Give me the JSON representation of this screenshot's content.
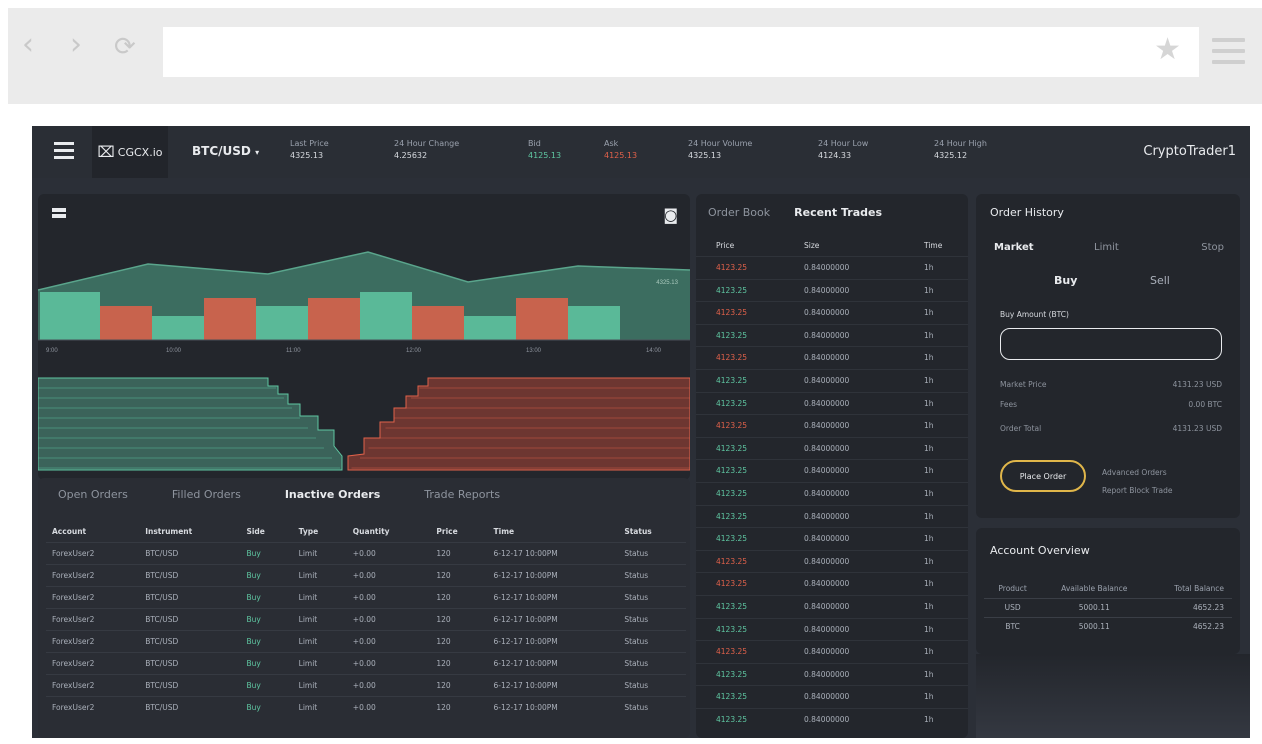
{
  "browser": {
    "back_icon": "chevron-left-icon",
    "forward_icon": "chevron-right-icon",
    "reload_icon": "reload-icon",
    "url_value": "",
    "bookmark_icon": "star-icon",
    "menu_icon": "hamburger-menu-icon"
  },
  "topbar": {
    "logo_text": "CGCX.io",
    "pair": "BTC/USD",
    "pair_caret": "▾",
    "stats": [
      {
        "label": "Last Price",
        "value": "4325.13",
        "color": "neutral"
      },
      {
        "label": "24 Hour Change",
        "value": "4.25632",
        "color": "neutral"
      },
      {
        "label": "Bid",
        "value": "4125.13",
        "color": "green"
      },
      {
        "label": "Ask",
        "value": "4125.13",
        "color": "red"
      },
      {
        "label": "24 Hour Volume",
        "value": "4325.13",
        "color": "neutral"
      },
      {
        "label": "24 Hour Low",
        "value": "4124.33",
        "color": "neutral"
      },
      {
        "label": "24 Hour High",
        "value": "4325.12",
        "color": "neutral"
      }
    ],
    "user": "CryptoTrader1"
  },
  "chart": {
    "last_label": "4325.13",
    "x_ticks": [
      "9:00",
      "10:00",
      "11:00",
      "12:00",
      "13:00",
      "14:00"
    ],
    "colors": {
      "up": "#5fc7a2",
      "down": "#e0614a",
      "area": "#4a8c78"
    }
  },
  "orders": {
    "tabs": [
      "Open Orders",
      "Filled Orders",
      "Inactive Orders",
      "Trade Reports"
    ],
    "active_tab": 2,
    "columns": [
      "Account",
      "Instrument",
      "Side",
      "Type",
      "Quantity",
      "Price",
      "Time",
      "Status"
    ],
    "rows": [
      [
        "ForexUser2",
        "BTC/USD",
        "Buy",
        "Limit",
        "+0.00",
        "120",
        "6-12-17 10:00PM",
        "Status"
      ],
      [
        "ForexUser2",
        "BTC/USD",
        "Buy",
        "Limit",
        "+0.00",
        "120",
        "6-12-17 10:00PM",
        "Status"
      ],
      [
        "ForexUser2",
        "BTC/USD",
        "Buy",
        "Limit",
        "+0.00",
        "120",
        "6-12-17 10:00PM",
        "Status"
      ],
      [
        "ForexUser2",
        "BTC/USD",
        "Buy",
        "Limit",
        "+0.00",
        "120",
        "6-12-17 10:00PM",
        "Status"
      ],
      [
        "ForexUser2",
        "BTC/USD",
        "Buy",
        "Limit",
        "+0.00",
        "120",
        "6-12-17 10:00PM",
        "Status"
      ],
      [
        "ForexUser2",
        "BTC/USD",
        "Buy",
        "Limit",
        "+0.00",
        "120",
        "6-12-17 10:00PM",
        "Status"
      ],
      [
        "ForexUser2",
        "BTC/USD",
        "Buy",
        "Limit",
        "+0.00",
        "120",
        "6-12-17 10:00PM",
        "Status"
      ],
      [
        "ForexUser2",
        "BTC/USD",
        "Buy",
        "Limit",
        "+0.00",
        "120",
        "6-12-17 10:00PM",
        "Status"
      ]
    ]
  },
  "book": {
    "tabs": [
      "Order Book",
      "Recent Trades"
    ],
    "active_tab": 1,
    "columns": [
      "Price",
      "Size",
      "Time"
    ],
    "rows": [
      {
        "price": "4123.25",
        "size": "0.84000000",
        "time": "1h",
        "side": "r"
      },
      {
        "price": "4123.25",
        "size": "0.84000000",
        "time": "1h",
        "side": "g"
      },
      {
        "price": "4123.25",
        "size": "0.84000000",
        "time": "1h",
        "side": "r"
      },
      {
        "price": "4123.25",
        "size": "0.84000000",
        "time": "1h",
        "side": "g"
      },
      {
        "price": "4123.25",
        "size": "0.84000000",
        "time": "1h",
        "side": "r"
      },
      {
        "price": "4123.25",
        "size": "0.84000000",
        "time": "1h",
        "side": "g"
      },
      {
        "price": "4123.25",
        "size": "0.84000000",
        "time": "1h",
        "side": "g"
      },
      {
        "price": "4123.25",
        "size": "0.84000000",
        "time": "1h",
        "side": "r"
      },
      {
        "price": "4123.25",
        "size": "0.84000000",
        "time": "1h",
        "side": "g"
      },
      {
        "price": "4123.25",
        "size": "0.84000000",
        "time": "1h",
        "side": "g"
      },
      {
        "price": "4123.25",
        "size": "0.84000000",
        "time": "1h",
        "side": "g"
      },
      {
        "price": "4123.25",
        "size": "0.84000000",
        "time": "1h",
        "side": "g"
      },
      {
        "price": "4123.25",
        "size": "0.84000000",
        "time": "1h",
        "side": "g"
      },
      {
        "price": "4123.25",
        "size": "0.84000000",
        "time": "1h",
        "side": "r"
      },
      {
        "price": "4123.25",
        "size": "0.84000000",
        "time": "1h",
        "side": "r"
      },
      {
        "price": "4123.25",
        "size": "0.84000000",
        "time": "1h",
        "side": "g"
      },
      {
        "price": "4123.25",
        "size": "0.84000000",
        "time": "1h",
        "side": "g"
      },
      {
        "price": "4123.25",
        "size": "0.84000000",
        "time": "1h",
        "side": "r"
      },
      {
        "price": "4123.25",
        "size": "0.84000000",
        "time": "1h",
        "side": "g"
      },
      {
        "price": "4123.25",
        "size": "0.84000000",
        "time": "1h",
        "side": "g"
      },
      {
        "price": "4123.25",
        "size": "0.84000000",
        "time": "1h",
        "side": "g"
      }
    ]
  },
  "history": {
    "title": "Order History",
    "market_tabs": [
      "Market",
      "Limit",
      "Stop"
    ],
    "side_tabs": [
      "Buy",
      "Sell"
    ],
    "amount_label": "Buy Amount (BTC)",
    "amount_value": "",
    "rows": [
      {
        "k": "Market Price",
        "v": "4131.23 USD"
      },
      {
        "k": "Fees",
        "v": "0.00 BTC"
      },
      {
        "k": "Order Total",
        "v": "4131.23 USD"
      }
    ],
    "place_order": "Place Order",
    "advanced": "Advanced Orders",
    "report": "Report Block Trade"
  },
  "account": {
    "title": "Account Overview",
    "columns": [
      "Product",
      "Available Balance",
      "Total Balance"
    ],
    "rows": [
      [
        "USD",
        "5000.11",
        "4652.23"
      ],
      [
        "BTC",
        "5000.11",
        "4652.23"
      ]
    ]
  }
}
